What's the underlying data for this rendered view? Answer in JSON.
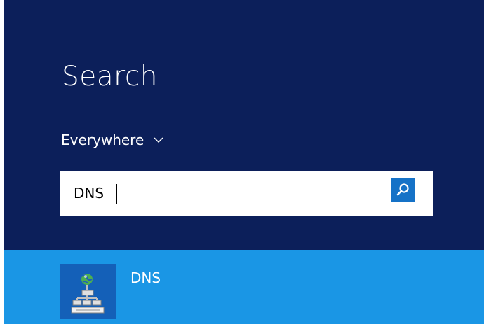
{
  "search_pane": {
    "title": "Search",
    "scope": {
      "selected": "Everywhere",
      "icon": "chevron-down-icon"
    },
    "query": {
      "value": "DNS",
      "button_icon": "search-icon"
    }
  },
  "results": [
    {
      "label": "DNS",
      "icon": "dns-app-icon"
    }
  ],
  "colors": {
    "pane_background": "#0c1f5a",
    "result_highlight": "#1a96e5",
    "search_button": "#1572c7",
    "tile_background": "#1460b8"
  }
}
